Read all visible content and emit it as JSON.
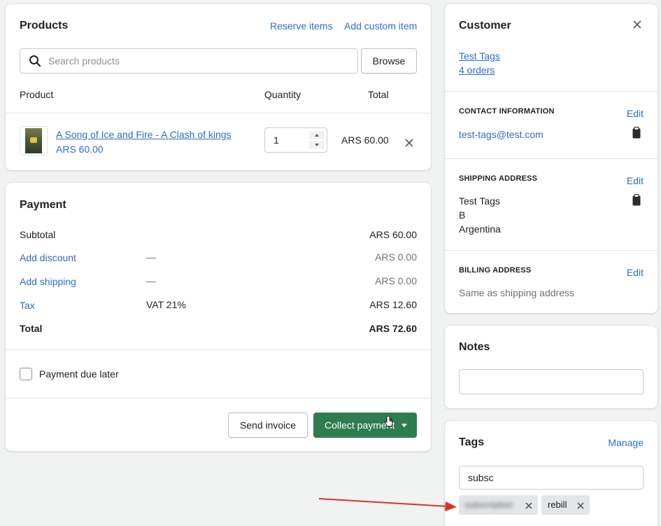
{
  "products": {
    "title": "Products",
    "reserve_items": "Reserve items",
    "add_custom_item": "Add custom item",
    "search_placeholder": "Search products",
    "browse_label": "Browse",
    "col_product": "Product",
    "col_quantity": "Quantity",
    "col_total": "Total",
    "items": [
      {
        "name": "A Song of Ice and Fire - A Clash of kings",
        "price": "ARS 60.00",
        "quantity": "1",
        "total": "ARS 60.00"
      }
    ]
  },
  "payment": {
    "title": "Payment",
    "subtotal_label": "Subtotal",
    "subtotal_value": "ARS 60.00",
    "discount_label": "Add discount",
    "discount_mid": "—",
    "discount_value": "ARS 0.00",
    "shipping_label": "Add shipping",
    "shipping_mid": "—",
    "shipping_value": "ARS 0.00",
    "tax_label": "Tax",
    "tax_mid": "VAT 21%",
    "tax_value": "ARS 12.60",
    "total_label": "Total",
    "total_value": "ARS 72.60",
    "due_later_label": "Payment due later",
    "send_invoice_label": "Send invoice",
    "collect_payment_label": "Collect payment"
  },
  "customer": {
    "title": "Customer",
    "name": "Test Tags",
    "orders": "4 orders",
    "contact_heading": "CONTACT INFORMATION",
    "contact_edit": "Edit",
    "email": "test-tags@test.com",
    "shipping_heading": "SHIPPING ADDRESS",
    "shipping_edit": "Edit",
    "address_lines": [
      "Test Tags",
      "B",
      "Argentina"
    ],
    "billing_heading": "BILLING ADDRESS",
    "billing_edit": "Edit",
    "billing_value": "Same as shipping address"
  },
  "notes": {
    "title": "Notes",
    "value": ""
  },
  "tags": {
    "title": "Tags",
    "manage_label": "Manage",
    "input_value": "subsc",
    "chips": [
      {
        "label": "subscription",
        "blurred": true
      },
      {
        "label": "rebill",
        "blurred": false
      }
    ]
  },
  "colors": {
    "accent": "#2c6ecb",
    "primary_button": "#2e7d4f",
    "annotation_arrow": "#d9342b"
  }
}
